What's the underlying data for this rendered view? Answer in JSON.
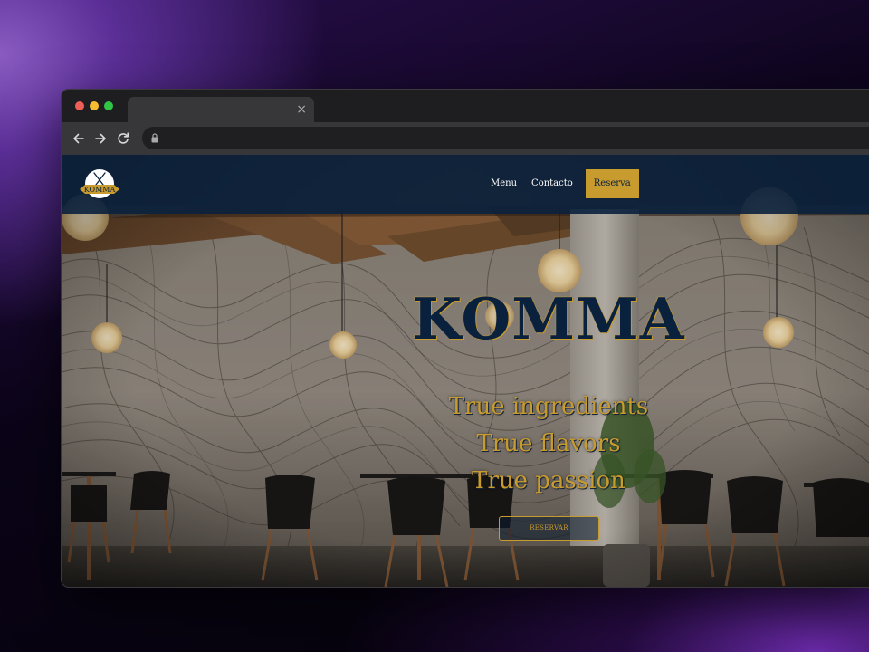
{
  "browser": {
    "tab": {
      "title": "",
      "close_label": "×"
    },
    "toolbar": {
      "back_icon": "arrow-left-icon",
      "forward_icon": "arrow-right-icon",
      "reload_icon": "reload-icon",
      "lock_icon": "lock-icon",
      "url": ""
    }
  },
  "site": {
    "logo": {
      "text": "KOMMA",
      "icon": "crossed-cutlery-icon"
    },
    "nav": {
      "items": [
        {
          "label": "Menu"
        },
        {
          "label": "Contacto"
        }
      ],
      "cta_label": "Reserva"
    },
    "hero": {
      "title": "KOMMA",
      "taglines": [
        "True ingredients",
        "True flavors",
        "True passion"
      ],
      "button_label": "RESERVAR"
    }
  },
  "colors": {
    "navy": "#0a213d",
    "gold": "#c79b2e",
    "header_bg": "#0a213d",
    "backdrop_purple": "#5b2f97"
  }
}
